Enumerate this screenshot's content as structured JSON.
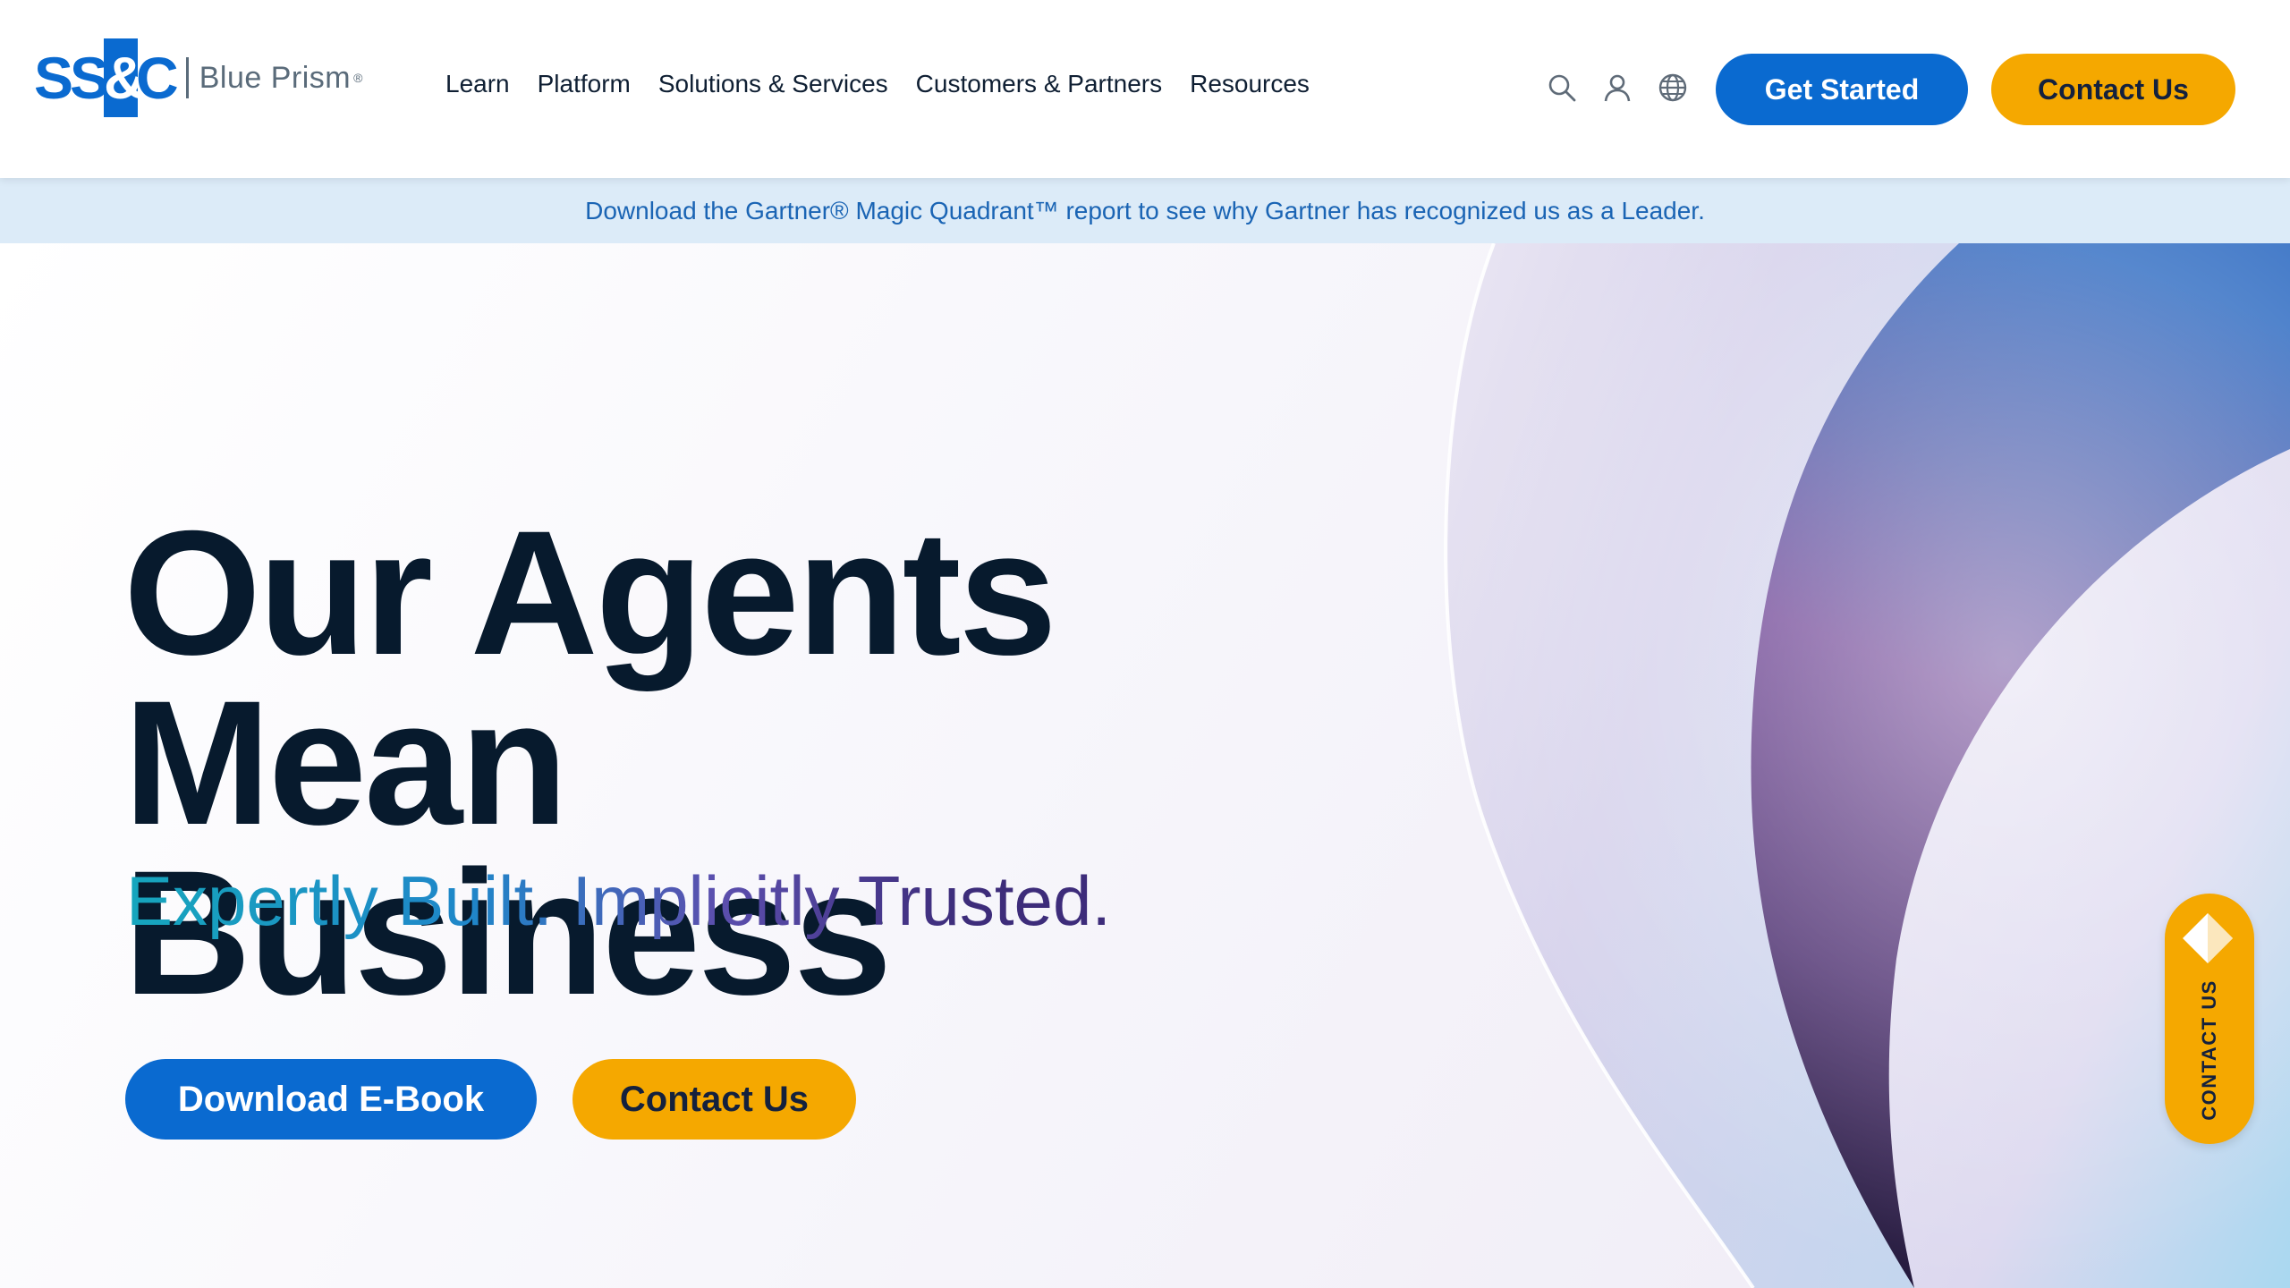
{
  "header": {
    "logo": {
      "mark": "SS&C",
      "brand": "Blue Prism",
      "reg": "®"
    },
    "nav": [
      "Learn",
      "Platform",
      "Solutions & Services",
      "Customers & Partners",
      "Resources"
    ],
    "icons": [
      "search-icon",
      "user-icon",
      "globe-icon"
    ],
    "get_started": "Get Started",
    "contact_us": "Contact Us"
  },
  "banner": {
    "text": "Download the Gartner® Magic Quadrant™ report to see why Gartner has recognized us as a Leader."
  },
  "hero": {
    "title_line1": "Our Agents",
    "title_line2": "Mean Business",
    "subtitle": "Expertly Built. Implicitly Trusted.",
    "primary_cta": "Download E-Book",
    "secondary_cta": "Contact Us"
  },
  "floating_tab": {
    "label": "CONTACT US",
    "icon": "chat-diamond-icon"
  },
  "colors": {
    "brand_blue": "#0a6ad0",
    "brand_gold": "#f5a800",
    "heading_navy": "#071a2d",
    "banner_bg": "#dcebf8",
    "banner_text": "#1a64b4"
  }
}
